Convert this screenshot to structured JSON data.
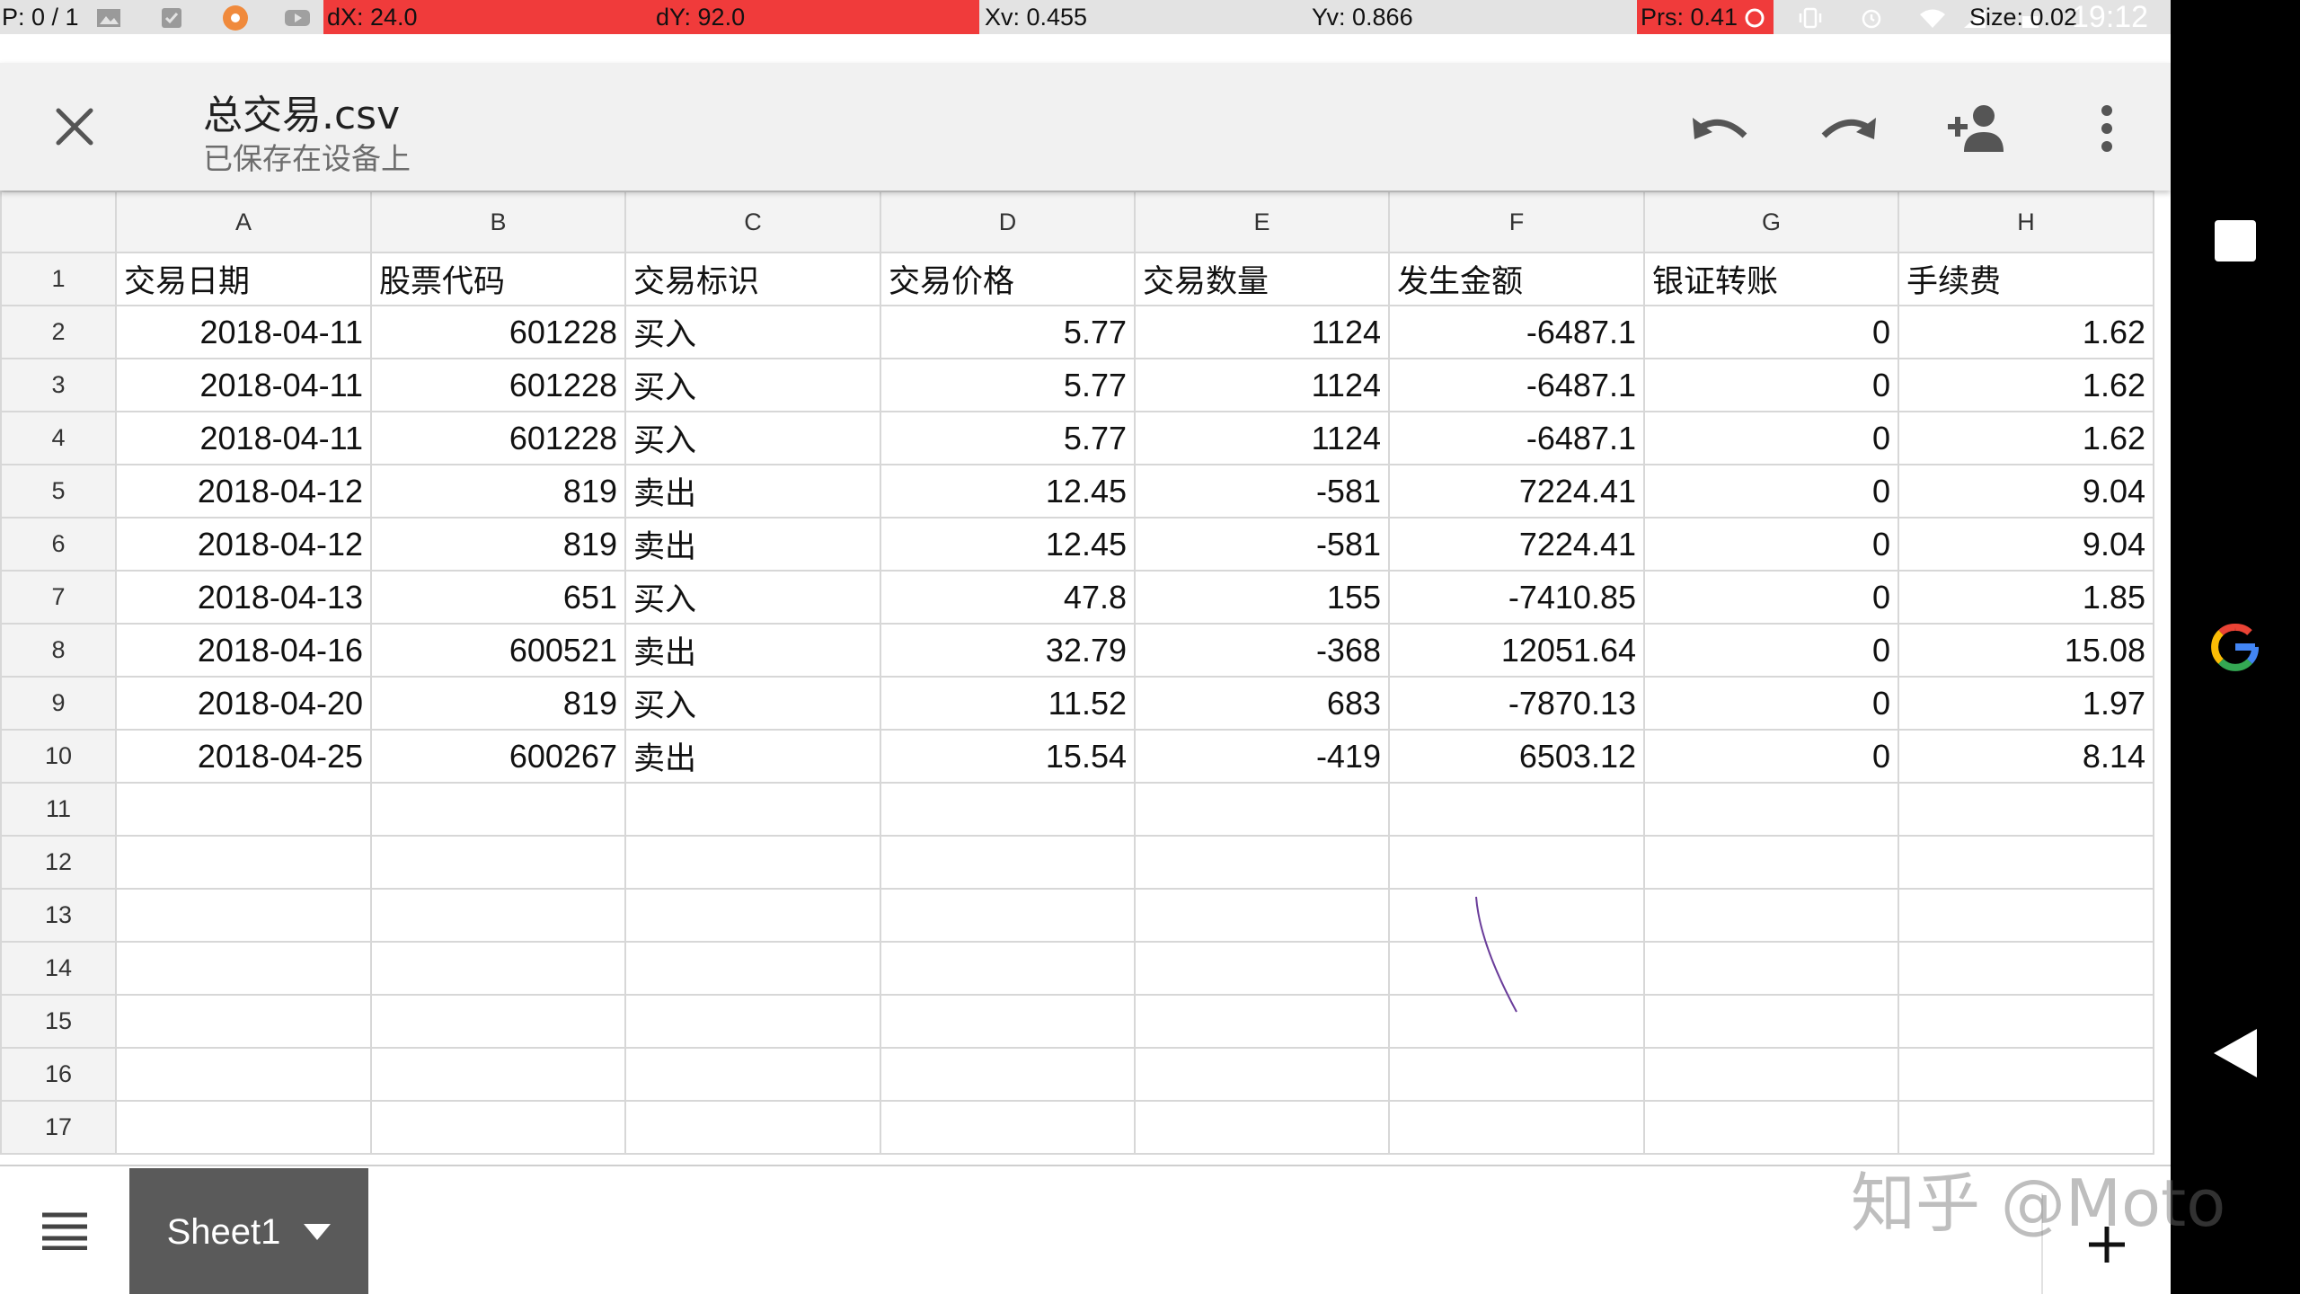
{
  "overlay": {
    "pointer": "P: 0 / 1",
    "dx": "dX: 24.0",
    "dy": "dY: 92.0",
    "xv": "Xv: 0.455",
    "yv": "Yv: 0.866",
    "prs": "Prs: 0.41",
    "size": "Size: 0.02",
    "time": "19:12"
  },
  "app": {
    "title": "总交易.csv",
    "subtitle": "已保存在设备上",
    "icons": [
      "close-icon",
      "undo-icon",
      "redo-icon",
      "share-person-add-icon",
      "more-vert-icon"
    ]
  },
  "sheet": {
    "columns": [
      "A",
      "B",
      "C",
      "D",
      "E",
      "F",
      "G",
      "H"
    ],
    "row_numbers": [
      "1",
      "2",
      "3",
      "4",
      "5",
      "6",
      "7",
      "8",
      "9",
      "10",
      "11",
      "12",
      "13",
      "14",
      "15",
      "16",
      "17"
    ],
    "header_row": [
      "交易日期",
      "股票代码",
      "交易标识",
      "交易价格",
      "交易数量",
      "发生金额",
      "银证转账",
      "手续费"
    ],
    "rows": [
      [
        "2018-04-11",
        "601228",
        "买入",
        "5.77",
        "1124",
        "-6487.1",
        "0",
        "1.62"
      ],
      [
        "2018-04-11",
        "601228",
        "买入",
        "5.77",
        "1124",
        "-6487.1",
        "0",
        "1.62"
      ],
      [
        "2018-04-11",
        "601228",
        "买入",
        "5.77",
        "1124",
        "-6487.1",
        "0",
        "1.62"
      ],
      [
        "2018-04-12",
        "819",
        "卖出",
        "12.45",
        "-581",
        "7224.41",
        "0",
        "9.04"
      ],
      [
        "2018-04-12",
        "819",
        "卖出",
        "12.45",
        "-581",
        "7224.41",
        "0",
        "9.04"
      ],
      [
        "2018-04-13",
        "651",
        "买入",
        "47.8",
        "155",
        "-7410.85",
        "0",
        "1.85"
      ],
      [
        "2018-04-16",
        "600521",
        "卖出",
        "32.79",
        "-368",
        "12051.64",
        "0",
        "15.08"
      ],
      [
        "2018-04-20",
        "819",
        "买入",
        "11.52",
        "683",
        "-7870.13",
        "0",
        "1.97"
      ],
      [
        "2018-04-25",
        "600267",
        "卖出",
        "15.54",
        "-419",
        "6503.12",
        "0",
        "8.14"
      ]
    ]
  },
  "bottom": {
    "sheet_tab": "Sheet1",
    "watermark": "知乎 @Moto"
  },
  "colors": {
    "overlay_red": "#f03b3b",
    "appbar_bg": "#f1f1f1",
    "grid_line": "#d7d7d7",
    "sheet_tab_bg": "#5a5a5a",
    "navbar_bg": "#000000"
  }
}
